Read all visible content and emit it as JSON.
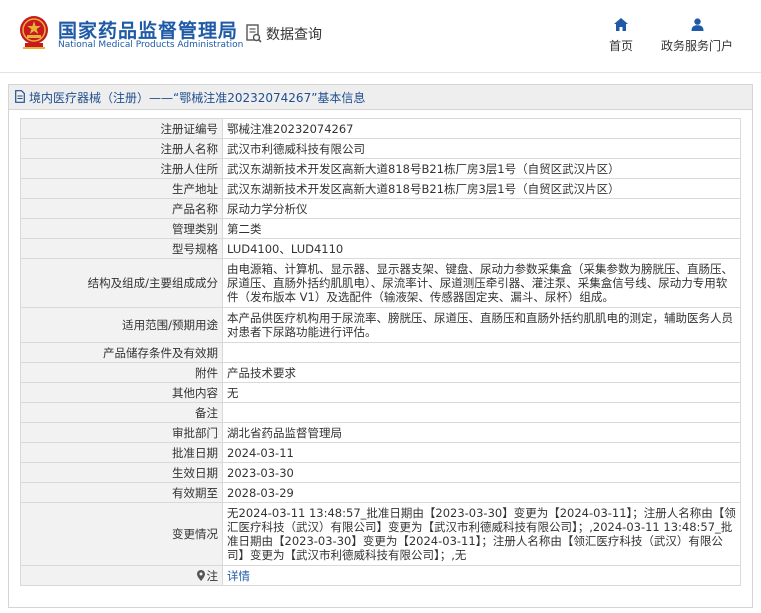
{
  "header": {
    "site_title": "国家药品监督管理局",
    "site_subtitle": "National Medical Products Administration",
    "query_label": "数据查询",
    "nav": {
      "home": "首页",
      "portal": "政务服务门户"
    },
    "colors": {
      "brand": "#1f5aa6",
      "emblem_red": "#c8191e",
      "emblem_gold": "#e8b23a"
    }
  },
  "breadcrumb": "境内医疗器械（注册）——“鄂械注准20232074267”基本信息",
  "fields": [
    {
      "label": "注册证编号",
      "value": "鄂械注准20232074267"
    },
    {
      "label": "注册人名称",
      "value": "武汉市利德威科技有限公司"
    },
    {
      "label": "注册人住所",
      "value": "武汉东湖新技术开发区高新大道818号B21栋厂房3层1号（自贸区武汉片区）"
    },
    {
      "label": "生产地址",
      "value": "武汉东湖新技术开发区高新大道818号B21栋厂房3层1号（自贸区武汉片区）"
    },
    {
      "label": "产品名称",
      "value": "尿动力学分析仪"
    },
    {
      "label": "管理类别",
      "value": "第二类"
    },
    {
      "label": "型号规格",
      "value": "LUD4100、LUD4110"
    },
    {
      "label": "结构及组成/主要组成成分",
      "value": "由电源箱、计算机、显示器、显示器支架、键盘、尿动力参数采集盒（采集参数为膀胱压、直肠压、尿道压、直肠外括约肌肌电）、尿流率计、尿道测压牵引器、灌注泵、采集盒信号线、尿动力专用软件（发布版本 V1）及选配件（输液架、传感器固定夹、漏斗、尿杯）组成。"
    },
    {
      "label": "适用范围/预期用途",
      "value": "本产品供医疗机构用于尿流率、膀胱压、尿道压、直肠压和直肠外括约肌肌电的测定，辅助医务人员对患者下尿路功能进行评估。"
    },
    {
      "label": "产品储存条件及有效期",
      "value": ""
    },
    {
      "label": "附件",
      "value": "产品技术要求"
    },
    {
      "label": "其他内容",
      "value": "无"
    },
    {
      "label": "备注",
      "value": ""
    },
    {
      "label": "审批部门",
      "value": "湖北省药品监督管理局"
    },
    {
      "label": "批准日期",
      "value": "2024-03-11"
    },
    {
      "label": "生效日期",
      "value": "2023-03-30"
    },
    {
      "label": "有效期至",
      "value": "2028-03-29"
    },
    {
      "label": "变更情况",
      "value": "无2024-03-11 13:48:57_批准日期由【2023-03-30】变更为【2024-03-11】；注册人名称由【领汇医疗科技（武汉）有限公司】变更为【武汉市利德威科技有限公司】；,2024-03-11 13:48:57_批准日期由【2023-03-30】变更为【2024-03-11】；注册人名称由【领汇医疗科技（武汉）有限公司】变更为【武汉市利德威科技有限公司】；,无"
    },
    {
      "label": "注",
      "value": "详情"
    }
  ]
}
